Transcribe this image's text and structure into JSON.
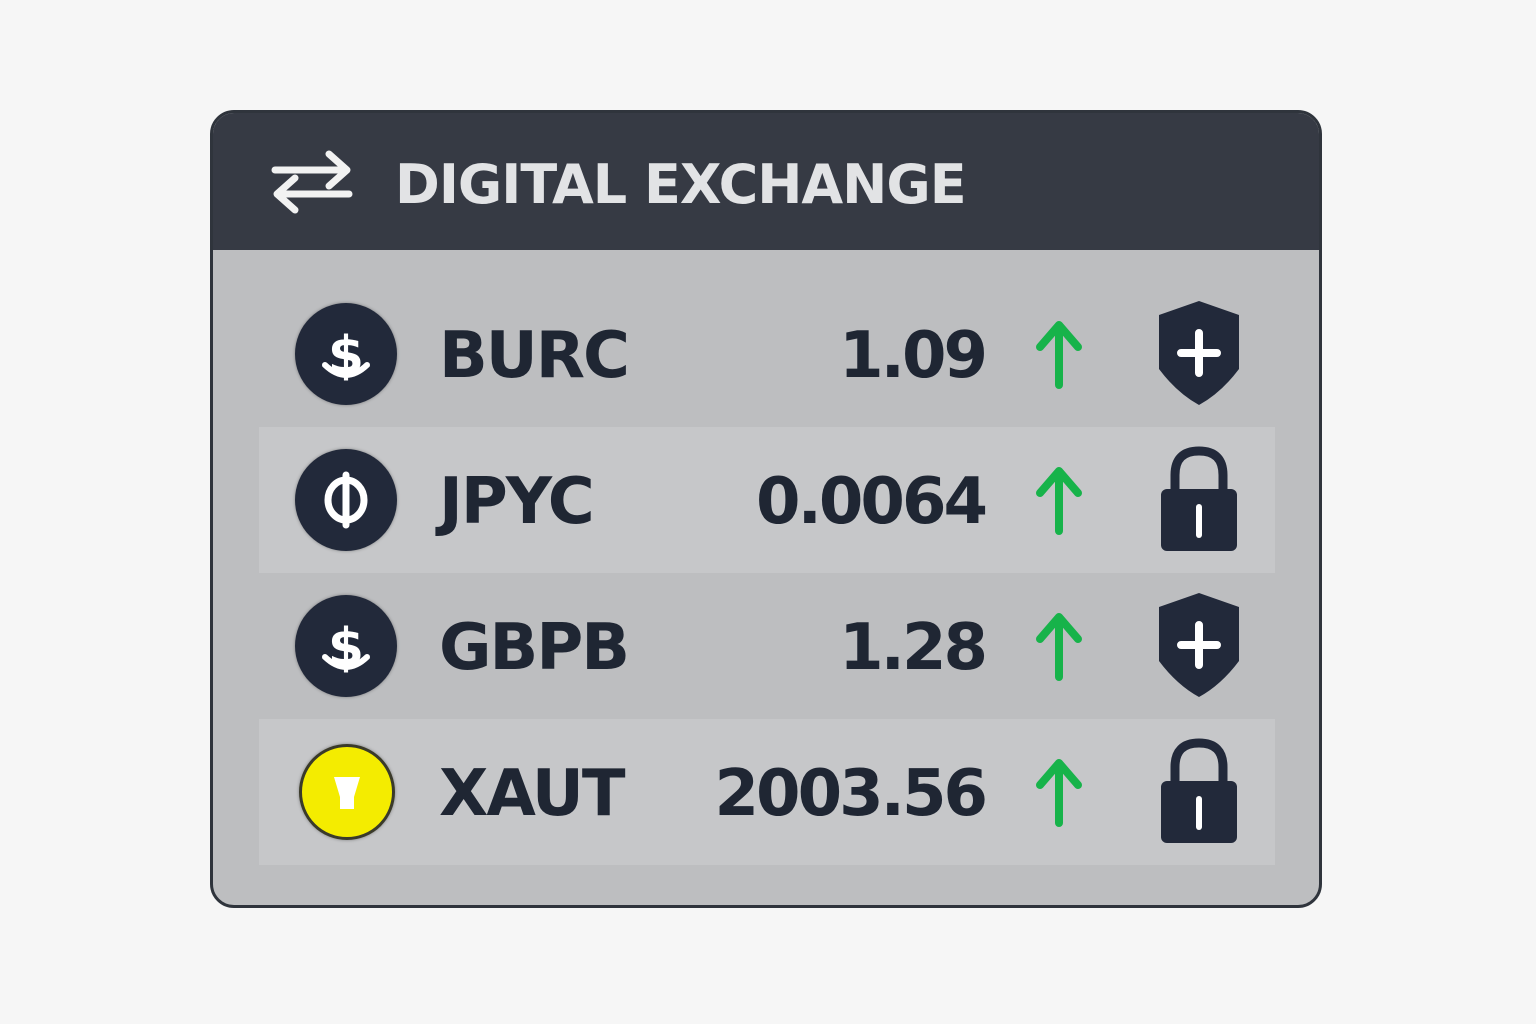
{
  "header": {
    "title": "DIGITAL EXCHANGE",
    "icon": "exchange-arrows-icon"
  },
  "colors": {
    "header_bg": "#363a44",
    "panel_bg": "#bdbec0",
    "row_alt_bg": "#c6c7c9",
    "coin_dark": "#22293a",
    "coin_gold": "#f4ec00",
    "trend_up": "#17b34a",
    "text_dark": "#1f2633"
  },
  "rows": [
    {
      "symbol": "BURC",
      "price": "1.09",
      "coin_icon": "dollar-coin-icon",
      "trend": "up-arrow-icon",
      "action_icon": "shield-plus-icon"
    },
    {
      "symbol": "JPYC",
      "price": "0.0064",
      "coin_icon": "yen-coin-icon",
      "trend": "up-arrow-icon",
      "action_icon": "lock-icon"
    },
    {
      "symbol": "GBPB",
      "price": "1.28",
      "coin_icon": "dollar-coin-icon",
      "trend": "up-arrow-icon",
      "action_icon": "shield-plus-icon"
    },
    {
      "symbol": "XAUT",
      "price": "2003.56",
      "coin_icon": "gold-coin-icon",
      "trend": "up-arrow-icon",
      "action_icon": "lock-icon"
    }
  ]
}
